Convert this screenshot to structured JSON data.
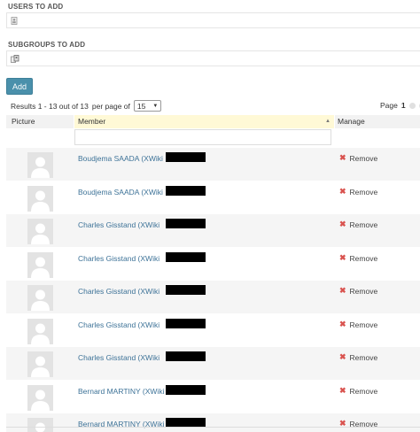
{
  "users_to_add": {
    "label": "USERS TO ADD",
    "icon": "user-picker-icon",
    "value": ""
  },
  "subgroups_to_add": {
    "label": "SUBGROUPS TO ADD",
    "icon": "group-picker-icon",
    "value": ""
  },
  "add_button": {
    "label": "Add"
  },
  "results": {
    "summary": "Results 1 - 13 out of 13",
    "per_page_label": "per page of",
    "per_page_value": "15"
  },
  "pagination": {
    "label": "Page",
    "current": "1"
  },
  "table": {
    "columns": [
      "Picture",
      "Member",
      "Manage"
    ],
    "member_filter": "",
    "rows": [
      {
        "member": "Boudjema SAADA (XWiki",
        "action": "Remove"
      },
      {
        "member": "Boudjema SAADA (XWiki",
        "action": "Remove"
      },
      {
        "member": "Charles Gisstand (XWiki",
        "action": "Remove"
      },
      {
        "member": "Charles Gisstand (XWiki",
        "action": "Remove"
      },
      {
        "member": "Charles Gisstand (XWiki",
        "action": "Remove"
      },
      {
        "member": "Charles Gisstand (XWiki",
        "action": "Remove"
      },
      {
        "member": "Charles Gisstand (XWiki",
        "action": "Remove"
      },
      {
        "member": "Bernard MARTINY (XWiki",
        "action": "Remove"
      },
      {
        "member": "Bernard MARTINY (XWiki",
        "action": "Remove"
      }
    ]
  },
  "colors": {
    "link": "#3e7398",
    "accent": "#4a90ab",
    "remove_icon": "#d9534f",
    "sorted_header": "#fff9d6"
  }
}
